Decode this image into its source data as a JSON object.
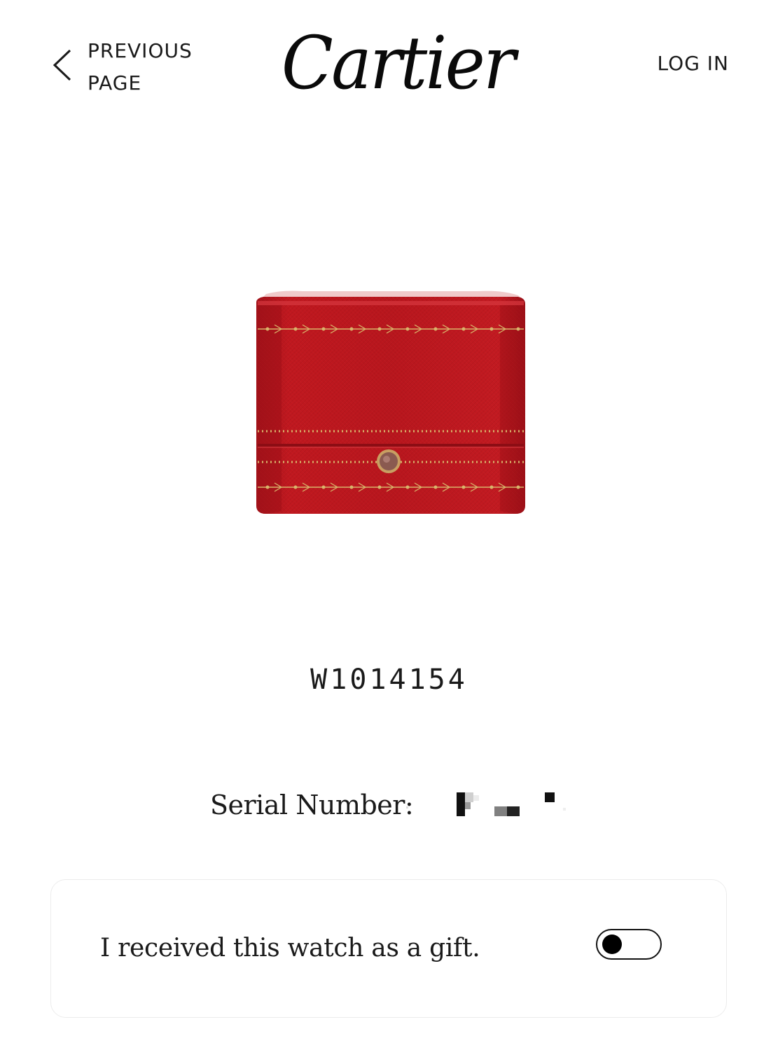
{
  "header": {
    "back_label_line1": "PREVIOUS",
    "back_label_line2": "PAGE",
    "back_icon": "chevron-left-icon",
    "logo_text": "Cartier",
    "login_label": "LOG IN"
  },
  "product": {
    "image_description_icon": "red-cartier-box-image",
    "box_color": "#b3151c",
    "gold_color": "#d8b46a",
    "reference": "W1014154"
  },
  "serial": {
    "label": "Serial Number:",
    "value_redacted": true
  },
  "gift": {
    "text": "I received this watch as a gift.",
    "toggle_on": false
  }
}
